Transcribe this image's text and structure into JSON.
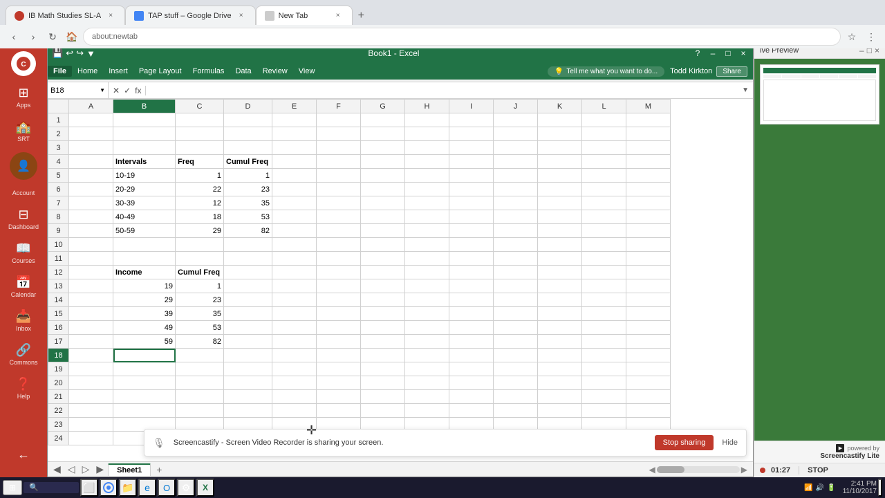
{
  "browser": {
    "tabs": [
      {
        "id": "tab1",
        "title": "IB Math Studies SL-A",
        "favicon_color": "#c0392b",
        "active": false
      },
      {
        "id": "tab2",
        "title": "TAP stuff – Google Drive",
        "favicon_color": "#4285f4",
        "active": false
      },
      {
        "id": "tab3",
        "title": "New Tab",
        "favicon_color": "#888",
        "active": true
      }
    ],
    "address": ""
  },
  "sidebar": {
    "items": [
      {
        "id": "account",
        "label": "Account",
        "icon": "👤"
      },
      {
        "id": "dashboard",
        "label": "Dashboard",
        "icon": "🏠"
      },
      {
        "id": "courses",
        "label": "Courses",
        "icon": "📚"
      },
      {
        "id": "calendar",
        "label": "Calendar",
        "icon": "📅"
      },
      {
        "id": "inbox",
        "label": "Inbox",
        "icon": "📧"
      },
      {
        "id": "commons",
        "label": "Commons",
        "icon": "🔗"
      },
      {
        "id": "help",
        "label": "Help",
        "icon": "❓"
      }
    ],
    "apps_label": "Apps",
    "srti_label": "SRT"
  },
  "excel": {
    "title": "Book1 - Excel",
    "name_box": "B18",
    "quick_access": [
      "💾",
      "↩",
      "↪",
      "✎"
    ],
    "menu_items": [
      "File",
      "Home",
      "Insert",
      "Page Layout",
      "Formulas",
      "Data",
      "Review",
      "View"
    ],
    "tell_me": "Tell me what you want to do...",
    "user": "Todd Kirkton",
    "share": "Share",
    "columns": [
      "A",
      "B",
      "C",
      "D",
      "E",
      "F",
      "G",
      "H",
      "I",
      "J",
      "K",
      "L",
      "M"
    ],
    "rows": [
      1,
      2,
      3,
      4,
      5,
      6,
      7,
      8,
      9,
      10,
      11,
      12,
      13,
      14,
      15,
      16,
      17,
      18,
      19,
      20,
      21,
      22,
      23,
      24
    ],
    "data": {
      "B4": "Intervals",
      "C4": "Freq",
      "D4": "Cumul Freq",
      "B5": "10-19",
      "C5": "1",
      "D5": "1",
      "B6": "20-29",
      "C6": "22",
      "D6": "23",
      "B7": "30-39",
      "C7": "12",
      "D7": "35",
      "B8": "40-49",
      "C8": "18",
      "D8": "53",
      "B9": "50-59",
      "C9": "29",
      "D9": "82",
      "B12": "Income",
      "C12": "Cumul Freq",
      "B13": "19",
      "C13": "1",
      "B14": "29",
      "C14": "23",
      "B15": "39",
      "C15": "35",
      "B16": "49",
      "C16": "53",
      "B17": "59",
      "C17": "82"
    },
    "selected_cell": "B18",
    "sheet_tab": "Sheet1"
  },
  "screencastify": {
    "panel_title": "ive Preview",
    "bar_text": "Screencastify - Screen Video Recorder is sharing your screen.",
    "stop_button": "Stop sharing",
    "hide_button": "Hide",
    "time": "01:27",
    "stop_label": "STOP",
    "powered_by": "powered by",
    "brand": "Screencastify Lite"
  },
  "taskbar": {
    "time": "2:41 PM",
    "date": "11/10/2017"
  }
}
